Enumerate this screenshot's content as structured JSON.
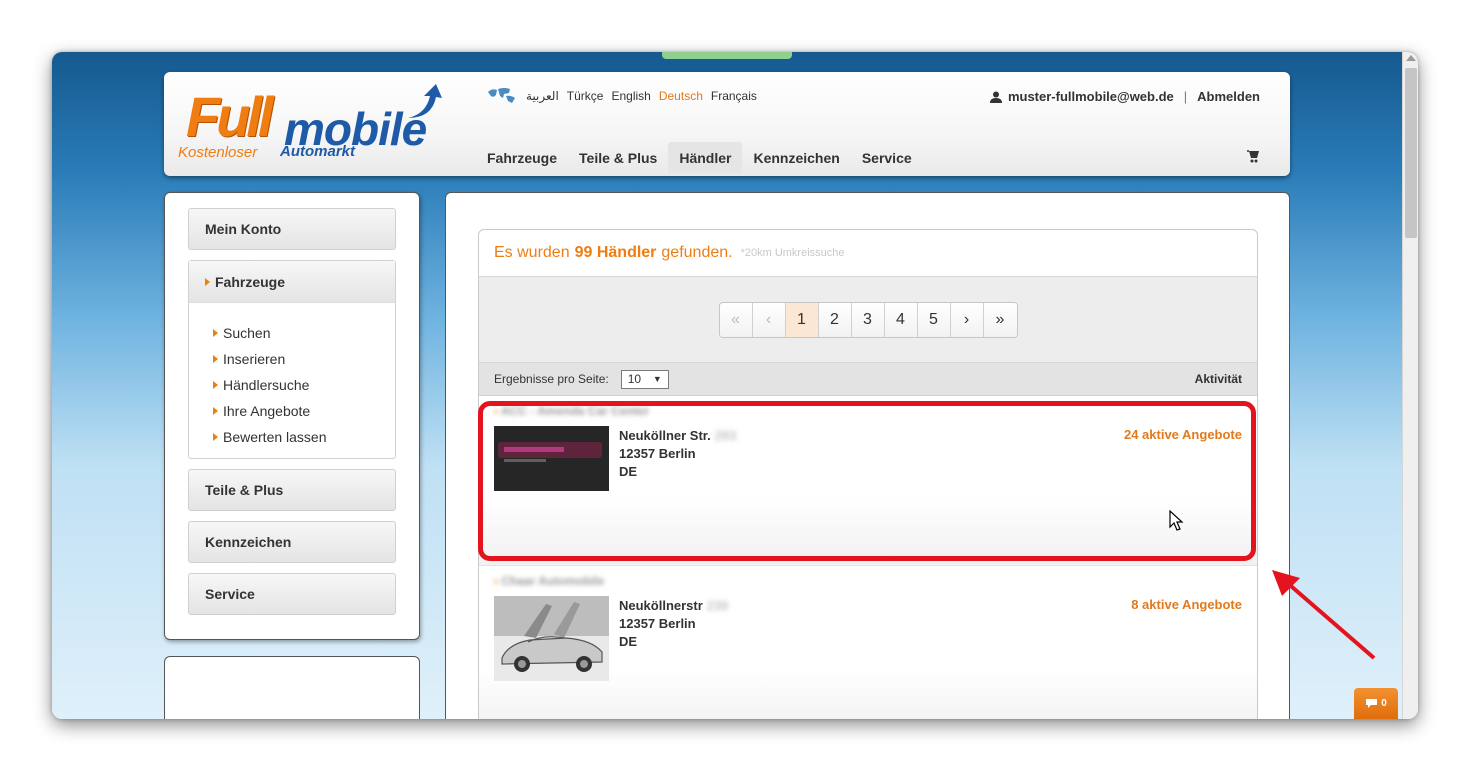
{
  "header": {
    "logo": {
      "word_a": "Full",
      "word_b": "mobile",
      "tagline_a": "Kostenloser",
      "tagline_b": "Automarkt"
    },
    "languages": [
      {
        "label": "العربية",
        "active": false
      },
      {
        "label": "Türkçe",
        "active": false
      },
      {
        "label": "English",
        "active": false
      },
      {
        "label": "Deutsch",
        "active": true
      },
      {
        "label": "Français",
        "active": false
      }
    ],
    "user_email": "muster-fullmobile@web.de",
    "separator": "|",
    "logout_label": "Abmelden",
    "nav": [
      {
        "label": "Fahrzeuge",
        "active": false
      },
      {
        "label": "Teile & Plus",
        "active": false
      },
      {
        "label": "Händler",
        "active": true
      },
      {
        "label": "Kennzeichen",
        "active": false
      },
      {
        "label": "Service",
        "active": false
      }
    ]
  },
  "sidebar": {
    "mein_konto": "Mein Konto",
    "fahrzeuge": "Fahrzeuge",
    "fahrzeuge_items": [
      "Suchen",
      "Inserieren",
      "Händlersuche",
      "Ihre Angebote",
      "Bewerten lassen"
    ],
    "teile_plus": "Teile & Plus",
    "kennzeichen": "Kennzeichen",
    "service": "Service"
  },
  "results": {
    "prefix": "Es wurden",
    "count": "99 Händler",
    "suffix": "gefunden.",
    "radius_note": "*20km Umkreissuche",
    "pagination": {
      "first": "«",
      "prev": "‹",
      "pages": [
        "1",
        "2",
        "3",
        "4",
        "5"
      ],
      "current": "1",
      "next": "›",
      "last": "»"
    },
    "per_page_label": "Ergebnisse pro Seite:",
    "per_page_value": "10",
    "activity_label": "Aktivität",
    "dealers": [
      {
        "name": "ACC - Amenda Car Center",
        "street": "Neuköllner Str.",
        "number": "283",
        "city": "12357 Berlin",
        "country": "DE",
        "offers": "24 aktive Angebote"
      },
      {
        "name": "Chaar Automobile",
        "street": "Neuköllnerstr",
        "number": "239",
        "city": "12357 Berlin",
        "country": "DE",
        "offers": "8 aktive Angebote"
      }
    ]
  },
  "chat": {
    "count": "0"
  },
  "colors": {
    "accent": "#ef7d12",
    "brand_blue": "#1e5aa8",
    "highlight": "#e4141e"
  }
}
